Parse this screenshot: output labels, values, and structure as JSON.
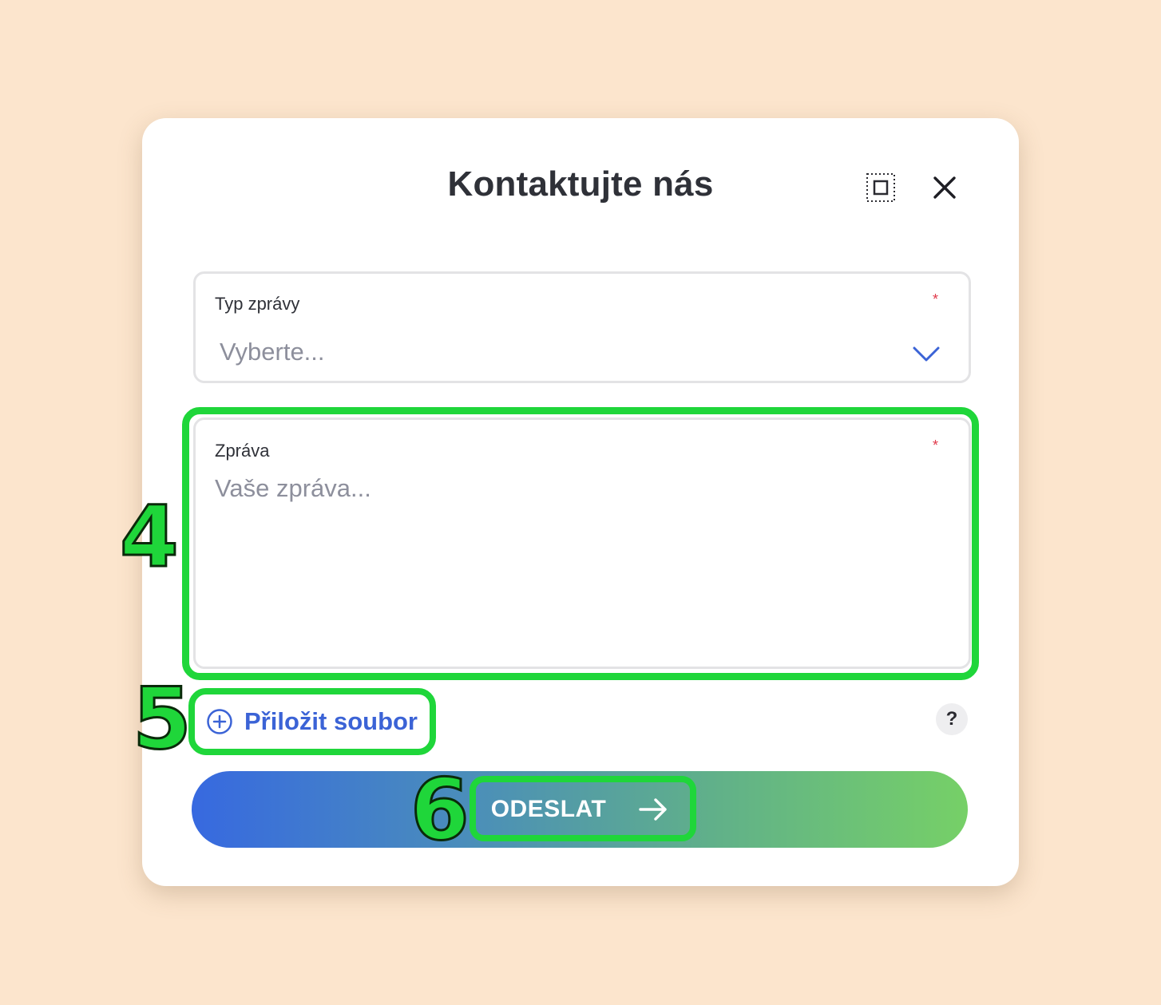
{
  "dialog": {
    "title": "Kontaktujte nás",
    "expand_icon": "expand-icon",
    "close_icon": "close-icon"
  },
  "message_type": {
    "label": "Typ zprávy",
    "required_mark": "*",
    "placeholder": "Vyberte...",
    "icon": "chevron-down-icon"
  },
  "message": {
    "label": "Zpráva",
    "required_mark": "*",
    "placeholder": "Vaše zpráva..."
  },
  "attach": {
    "label": "Přiložit soubor",
    "icon": "plus-circle-icon"
  },
  "help": {
    "label": "?"
  },
  "submit": {
    "label": "ODESLAT",
    "icon": "arrow-right-icon"
  },
  "annotations": [
    {
      "number": "4"
    },
    {
      "number": "5"
    },
    {
      "number": "6"
    }
  ],
  "colors": {
    "page_background": "#fce5cd",
    "accent_blue": "#3b63d6",
    "highlight_green": "#1fd63a",
    "required_red": "#e0394a",
    "gradient_start": "#3769e0",
    "gradient_end": "#76d067"
  }
}
